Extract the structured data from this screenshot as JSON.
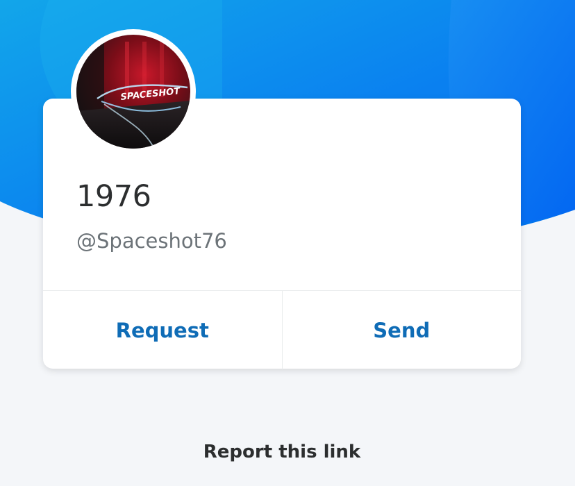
{
  "profile": {
    "display_name": "1976",
    "username": "@Spaceshot76",
    "avatar_text": "SPACESHOT"
  },
  "actions": {
    "request_label": "Request",
    "send_label": "Send"
  },
  "footer": {
    "report_label": "Report this link"
  },
  "colors": {
    "hero_blue": "#0a7df2",
    "hero_blue_dark": "#0066f0",
    "hero_cyan": "#14a8e8",
    "page_background": "#f4f6f9",
    "action_text": "#0f6cb6",
    "primary_text": "#2c2e2f",
    "secondary_text": "#6c7378"
  }
}
